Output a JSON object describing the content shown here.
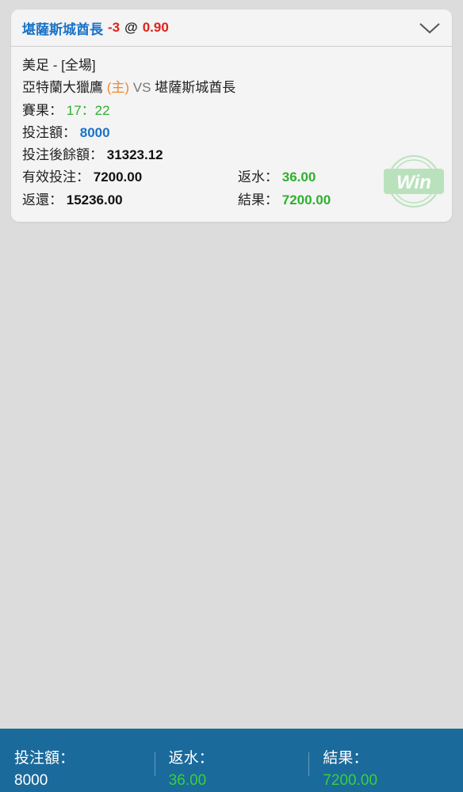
{
  "bet": {
    "team": "堪薩斯城酋長",
    "handicap": "-3",
    "at": "@",
    "odds": "0.90"
  },
  "details": {
    "league": "美足 - [全場]",
    "home_team": "亞特蘭大獵鷹",
    "home_tag": "(主)",
    "vs": "VS",
    "away_team": "堪薩斯城酋長",
    "score_label": "賽果：",
    "score": "17：22",
    "stake_label": "投注額：",
    "stake": "8000",
    "balance_label": "投注後餘額：",
    "balance": "31323.12",
    "valid_label": "有效投注：",
    "valid": "7200.00",
    "rebate_label": "返水：",
    "rebate": "36.00",
    "return_label": "返還：",
    "return": "15236.00",
    "result_label": "結果：",
    "result": "7200.00",
    "stamp": "Win"
  },
  "footer": {
    "stake_label": "投注額：",
    "stake": "8000",
    "rebate_label": "返水：",
    "rebate": "36.00",
    "result_label": "結果：",
    "result": "7200.00"
  },
  "colors": {
    "header_team": "#1a73c8",
    "odds_red": "#e0221a",
    "green": "#2fb02f",
    "footer_bg": "#1b6a9c"
  },
  "icons": {
    "expand": "chevron-down-icon",
    "stamp": "win-stamp-icon"
  }
}
